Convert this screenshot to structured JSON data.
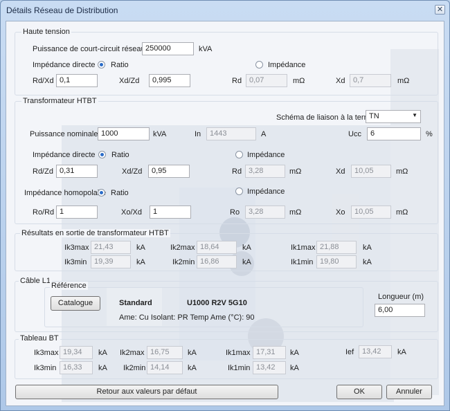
{
  "window": {
    "title": "Détails Réseau de Distribution",
    "close_glyph": "✕"
  },
  "ht": {
    "legend": "Haute tension",
    "pcc_label": "Puissance de court-circuit réseau",
    "pcc_value": "250000",
    "pcc_unit": "kVA",
    "imp_directe_label": "Impédance directe",
    "ratio_label": "Ratio",
    "impedance_label": "Impédance",
    "rdxd_label": "Rd/Xd",
    "rdxd_value": "0,1",
    "xdzd_label": "Xd/Zd",
    "xdzd_value": "0,995",
    "rd_label": "Rd",
    "rd_value": "0,07",
    "rd_unit": "mΩ",
    "xd_label": "Xd",
    "xd_value": "0,7",
    "xd_unit": "mΩ"
  },
  "tr": {
    "legend": "Transformateur HTBT",
    "schema_label": "Schéma de liaison à la terre",
    "schema_value": "TN",
    "pn_label": "Puissance nominale",
    "pn_value": "1000",
    "pn_unit": "kVA",
    "in_label": "In",
    "in_value": "1443",
    "in_unit": "A",
    "ucc_label": "Ucc",
    "ucc_value": "6",
    "ucc_unit": "%",
    "imp_directe_label": "Impédance directe",
    "ratio_label": "Ratio",
    "impedance_label": "Impédance",
    "rdzd_label": "Rd/Zd",
    "rdzd_value": "0,31",
    "xdzd_label": "Xd/Zd",
    "xdzd_value": "0,95",
    "rd_label": "Rd",
    "rd_value": "3,28",
    "rd_unit": "mΩ",
    "xd_label": "Xd",
    "xd_value": "10,05",
    "xd_unit": "mΩ",
    "imp_homo_label": "Impédance homopolaire",
    "ratio2_label": "Ratio",
    "impedance2_label": "Impédance",
    "rord_label": "Ro/Rd",
    "rord_value": "1",
    "xoxd_label": "Xo/Xd",
    "xoxd_value": "1",
    "ro_label": "Ro",
    "ro_value": "3,28",
    "ro_unit": "mΩ",
    "xo_label": "Xo",
    "xo_value": "10,05",
    "xo_unit": "mΩ"
  },
  "res": {
    "legend": "Résultats en sortie de transformateur HTBT",
    "ik3max_label": "Ik3max",
    "ik3max_value": "21,43",
    "ik2max_label": "Ik2max",
    "ik2max_value": "18,64",
    "ik1max_label": "Ik1max",
    "ik1max_value": "21,88",
    "ik3min_label": "Ik3min",
    "ik3min_value": "19,39",
    "ik2min_label": "Ik2min",
    "ik2min_value": "16,86",
    "ik1min_label": "Ik1min",
    "ik1min_value": "19,80",
    "unit": "kA"
  },
  "cable": {
    "legend": "Câble L1",
    "ref_legend": "Référence",
    "catalogue_label": "Catalogue",
    "standard_label": "Standard",
    "ref_value": "U1000 R2V 5G10",
    "details": "Ame: Cu   Isolant: PR   Temp Ame (°C): 90",
    "longueur_label": "Longueur (m)",
    "longueur_value": "6,00"
  },
  "bt": {
    "legend": "Tableau BT",
    "ik3max_label": "Ik3max",
    "ik3max_value": "19,34",
    "ik2max_label": "Ik2max",
    "ik2max_value": "16,75",
    "ik1max_label": "Ik1max",
    "ik1max_value": "17,31",
    "ief_label": "Ief",
    "ief_value": "13,42",
    "ik3min_label": "Ik3min",
    "ik3min_value": "16,33",
    "ik2min_label": "Ik2min",
    "ik2min_value": "14,14",
    "ik1min_label": "Ik1min",
    "ik1min_value": "13,42",
    "unit": "kA"
  },
  "buttons": {
    "reset": "Retour aux valeurs par défaut",
    "ok": "OK",
    "cancel": "Annuler"
  }
}
